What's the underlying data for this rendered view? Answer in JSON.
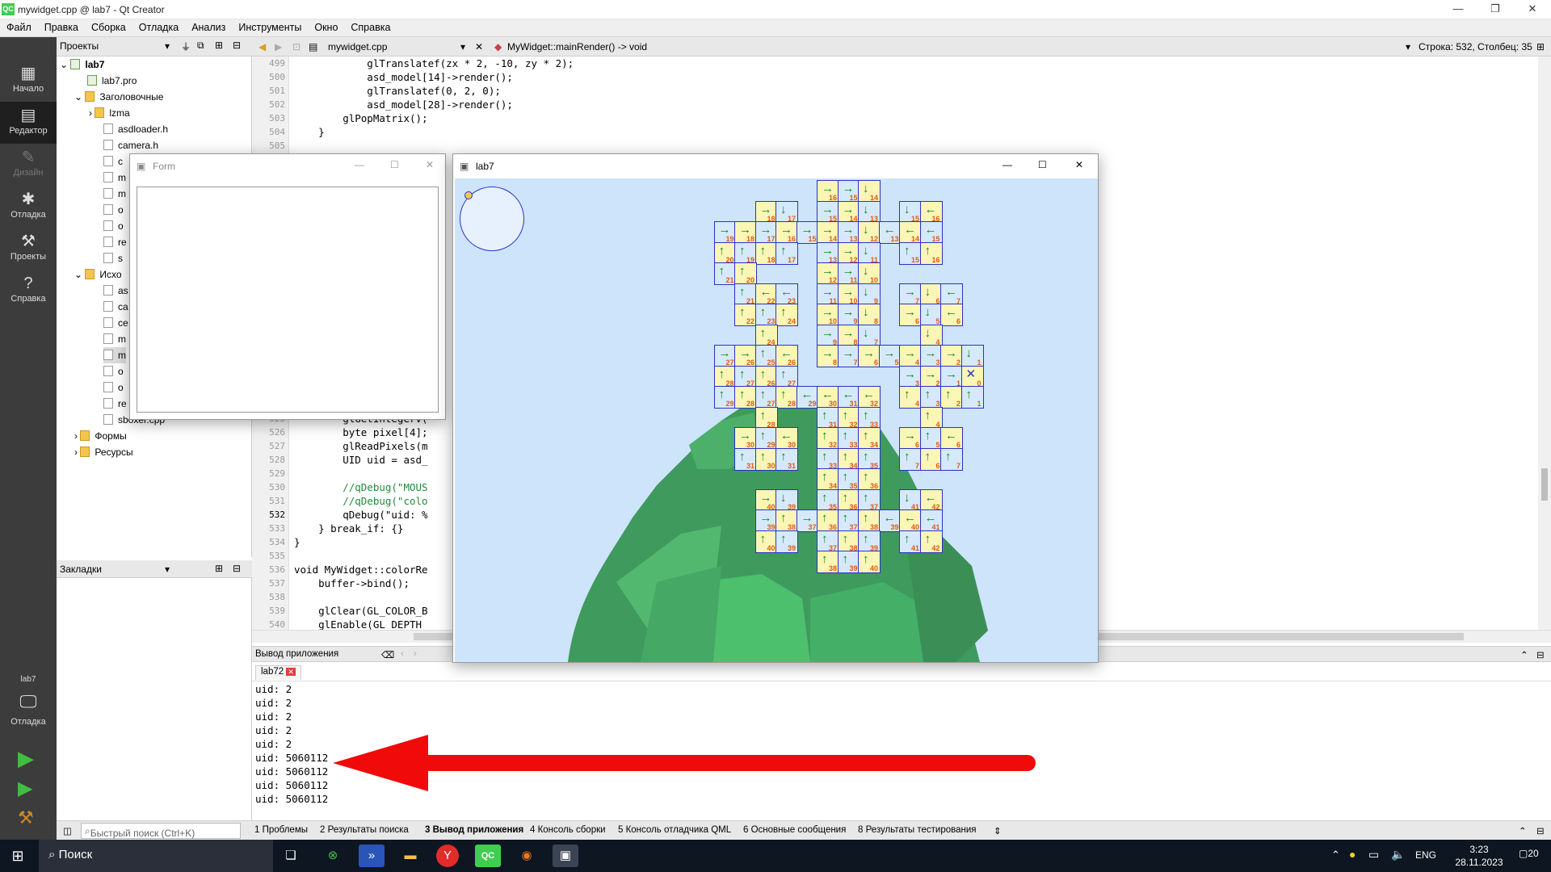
{
  "app": {
    "title": "mywidget.cpp @ lab7 - Qt Creator",
    "icon_text": "QC"
  },
  "window_controls": {
    "min": "—",
    "max": "❐",
    "close": "✕"
  },
  "menu": [
    "Файл",
    "Правка",
    "Сборка",
    "Отладка",
    "Анализ",
    "Инструменты",
    "Окно",
    "Справка"
  ],
  "modes": [
    {
      "label": "Начало",
      "icon": "grid-icon"
    },
    {
      "label": "Редактор",
      "icon": "editor-icon"
    },
    {
      "label": "Дизайн",
      "icon": "pen-icon"
    },
    {
      "label": "Отладка",
      "icon": "bug-icon"
    },
    {
      "label": "Проекты",
      "icon": "wrench-icon"
    },
    {
      "label": "Справка",
      "icon": "help-icon"
    }
  ],
  "kit": {
    "project": "lab7",
    "label": "Отладка"
  },
  "projects_panel": {
    "title": "Проекты",
    "items": [
      {
        "label": "lab7",
        "bold": true
      },
      {
        "label": "lab7.pro"
      },
      {
        "label": "Заголовочные"
      },
      {
        "label": "lzma"
      },
      {
        "label": "asdloader.h"
      },
      {
        "label": "camera.h"
      },
      {
        "label": "c"
      },
      {
        "label": "m"
      },
      {
        "label": "m"
      },
      {
        "label": "o"
      },
      {
        "label": "o"
      },
      {
        "label": "re"
      },
      {
        "label": "s"
      },
      {
        "label": "Исхо"
      },
      {
        "label": "as"
      },
      {
        "label": "ca"
      },
      {
        "label": "ce"
      },
      {
        "label": "m"
      },
      {
        "label": "m"
      },
      {
        "label": "o"
      },
      {
        "label": "o"
      },
      {
        "label": "re"
      },
      {
        "label": "sboxer.cpp"
      },
      {
        "label": "Формы"
      },
      {
        "label": "Ресурсы"
      }
    ]
  },
  "bookmarks_panel": {
    "title": "Закладки"
  },
  "editor": {
    "file": "mywidget.cpp",
    "function": "MyWidget::mainRender() -> void",
    "position": "Строка: 532, Столбец: 35",
    "lines": [
      {
        "n": "499",
        "text": "            glTranslatef(zx * 2, -10, zy * 2);"
      },
      {
        "n": "500",
        "text": "            asd_model[14]->render();"
      },
      {
        "n": "501",
        "text": "            glTranslatef(0, 2, 0);"
      },
      {
        "n": "502",
        "text": "            asd_model[28]->render();"
      },
      {
        "n": "503",
        "text": "        glPopMatrix();"
      },
      {
        "n": "504",
        "text": "    }"
      },
      {
        "n": "505",
        "text": ""
      },
      {
        "n": "525",
        "text": "        glGetIntegerv("
      },
      {
        "n": "526",
        "text": "        byte pixel[4];"
      },
      {
        "n": "527",
        "text": "        glReadPixels(m"
      },
      {
        "n": "528",
        "text": "        UID uid = asd_"
      },
      {
        "n": "529",
        "text": ""
      },
      {
        "n": "530",
        "text": "        //qDebug(\"MOUS"
      },
      {
        "n": "531",
        "text": "        //qDebug(\"colo"
      },
      {
        "n": "532",
        "text": "        qDebug(\"uid: %"
      },
      {
        "n": "533",
        "text": "    } break_if: {}"
      },
      {
        "n": "534",
        "text": "}"
      },
      {
        "n": "535",
        "text": ""
      },
      {
        "n": "536",
        "text": "void MyWidget::colorRe"
      },
      {
        "n": "537",
        "text": "    buffer->bind();"
      },
      {
        "n": "538",
        "text": ""
      },
      {
        "n": "539",
        "text": "    glClear(GL_COLOR_B"
      },
      {
        "n": "540",
        "text": "    glEnable(GL_DEPTH_"
      }
    ]
  },
  "output_panel": {
    "title": "Вывод приложения",
    "tab": "lab72",
    "lines": [
      "uid: 2",
      "uid: 2",
      "uid: 2",
      "uid: 2",
      "uid: 2",
      "uid: 5060112",
      "uid: 5060112",
      "uid: 5060112",
      "uid: 5060112"
    ]
  },
  "form_window": {
    "title": "Form"
  },
  "gl_window": {
    "title": "lab7"
  },
  "bottom_tabs": [
    {
      "label": "1  Проблемы"
    },
    {
      "label": "2  Результаты поиска"
    },
    {
      "label": "3  Вывод приложения"
    },
    {
      "label": "4  Консоль сборки"
    },
    {
      "label": "5  Консоль отладчика QML"
    },
    {
      "label": "6  Основные сообщения"
    },
    {
      "label": "8  Результаты тестирования"
    }
  ],
  "quick_search_placeholder": "Быстрый поиск (Ctrl+K)",
  "taskbar": {
    "search": "Поиск",
    "lang": "ENG",
    "time": "3:23",
    "date": "28.11.2023",
    "notif": "20"
  },
  "tiles": [
    [
      "r",
      16,
      0,
      0
    ],
    [
      "r",
      15,
      1,
      0
    ],
    [
      "d",
      14,
      2,
      0
    ],
    [
      "r",
      18,
      -3,
      1
    ],
    [
      "d",
      17,
      -2,
      1
    ],
    [
      "r",
      15,
      0,
      1
    ],
    [
      "r",
      14,
      1,
      1
    ],
    [
      "d",
      13,
      2,
      1
    ],
    [
      "d",
      15,
      4,
      1
    ],
    [
      "l",
      16,
      5,
      1
    ],
    [
      "r",
      19,
      -5,
      2
    ],
    [
      "r",
      18,
      -4,
      2
    ],
    [
      "r",
      17,
      -3,
      2
    ],
    [
      "r",
      16,
      -2,
      2
    ],
    [
      "r",
      15,
      -1,
      2
    ],
    [
      "r",
      14,
      0,
      2
    ],
    [
      "r",
      13,
      1,
      2
    ],
    [
      "d",
      12,
      2,
      2
    ],
    [
      "l",
      13,
      3,
      2
    ],
    [
      "l",
      14,
      4,
      2
    ],
    [
      "l",
      15,
      5,
      2
    ],
    [
      "u",
      20,
      -5,
      3
    ],
    [
      "u",
      19,
      -4,
      3
    ],
    [
      "u",
      18,
      -3,
      3
    ],
    [
      "u",
      17,
      -2,
      3
    ],
    [
      "r",
      13,
      0,
      3
    ],
    [
      "r",
      12,
      1,
      3
    ],
    [
      "d",
      11,
      2,
      3
    ],
    [
      "u",
      15,
      4,
      3
    ],
    [
      "u",
      16,
      5,
      3
    ],
    [
      "u",
      21,
      -5,
      4
    ],
    [
      "u",
      20,
      -4,
      4
    ],
    [
      "r",
      12,
      0,
      4
    ],
    [
      "r",
      11,
      1,
      4
    ],
    [
      "d",
      10,
      2,
      4
    ],
    [
      "u",
      21,
      -4,
      5
    ],
    [
      "l",
      22,
      -3,
      5
    ],
    [
      "l",
      23,
      -2,
      5
    ],
    [
      "r",
      11,
      0,
      5
    ],
    [
      "r",
      10,
      1,
      5
    ],
    [
      "d",
      9,
      2,
      5
    ],
    [
      "r",
      7,
      4,
      5
    ],
    [
      "d",
      6,
      5,
      5
    ],
    [
      "l",
      7,
      6,
      5
    ],
    [
      "u",
      22,
      -4,
      6
    ],
    [
      "u",
      23,
      -3,
      6
    ],
    [
      "u",
      24,
      -2,
      6
    ],
    [
      "r",
      10,
      0,
      6
    ],
    [
      "r",
      9,
      1,
      6
    ],
    [
      "d",
      8,
      2,
      6
    ],
    [
      "r",
      6,
      4,
      6
    ],
    [
      "d",
      5,
      5,
      6
    ],
    [
      "l",
      6,
      6,
      6
    ],
    [
      "u",
      24,
      -3,
      7
    ],
    [
      "r",
      9,
      0,
      7
    ],
    [
      "r",
      8,
      1,
      7
    ],
    [
      "d",
      7,
      2,
      7
    ],
    [
      "d",
      4,
      5,
      7
    ],
    [
      "r",
      27,
      -5,
      8
    ],
    [
      "r",
      26,
      -4,
      8
    ],
    [
      "u",
      25,
      -3,
      8
    ],
    [
      "l",
      26,
      -2,
      8
    ],
    [
      "r",
      8,
      0,
      8
    ],
    [
      "r",
      7,
      1,
      8
    ],
    [
      "r",
      6,
      2,
      8
    ],
    [
      "r",
      5,
      3,
      8
    ],
    [
      "r",
      4,
      4,
      8
    ],
    [
      "r",
      3,
      5,
      8
    ],
    [
      "r",
      2,
      6,
      8
    ],
    [
      "d",
      1,
      7,
      8
    ],
    [
      "u",
      28,
      -5,
      9
    ],
    [
      "u",
      27,
      -4,
      9
    ],
    [
      "u",
      26,
      -3,
      9
    ],
    [
      "u",
      27,
      -2,
      9
    ],
    [
      "r",
      3,
      4,
      9
    ],
    [
      "r",
      2,
      5,
      9
    ],
    [
      "r",
      1,
      6,
      9
    ],
    [
      "x",
      0,
      7,
      9
    ],
    [
      "u",
      29,
      -5,
      10
    ],
    [
      "u",
      28,
      -4,
      10
    ],
    [
      "u",
      27,
      -3,
      10
    ],
    [
      "u",
      28,
      -2,
      10
    ],
    [
      "l",
      29,
      -1,
      10
    ],
    [
      "l",
      30,
      0,
      10
    ],
    [
      "l",
      31,
      1,
      10
    ],
    [
      "l",
      32,
      2,
      10
    ],
    [
      "u",
      4,
      4,
      10
    ],
    [
      "u",
      3,
      5,
      10
    ],
    [
      "u",
      2,
      6,
      10
    ],
    [
      "u",
      1,
      7,
      10
    ],
    [
      "u",
      28,
      -3,
      11
    ],
    [
      "u",
      31,
      0,
      11
    ],
    [
      "u",
      32,
      1,
      11
    ],
    [
      "u",
      33,
      2,
      11
    ],
    [
      "u",
      4,
      5,
      11
    ],
    [
      "r",
      30,
      -4,
      12
    ],
    [
      "u",
      29,
      -3,
      12
    ],
    [
      "l",
      30,
      -2,
      12
    ],
    [
      "u",
      32,
      0,
      12
    ],
    [
      "u",
      33,
      1,
      12
    ],
    [
      "u",
      34,
      2,
      12
    ],
    [
      "r",
      6,
      4,
      12
    ],
    [
      "u",
      5,
      5,
      12
    ],
    [
      "l",
      6,
      6,
      12
    ],
    [
      "u",
      31,
      -4,
      13
    ],
    [
      "u",
      30,
      -3,
      13
    ],
    [
      "u",
      31,
      -2,
      13
    ],
    [
      "u",
      33,
      0,
      13
    ],
    [
      "u",
      34,
      1,
      13
    ],
    [
      "u",
      35,
      2,
      13
    ],
    [
      "u",
      7,
      4,
      13
    ],
    [
      "u",
      6,
      5,
      13
    ],
    [
      "u",
      7,
      6,
      13
    ],
    [
      "u",
      34,
      0,
      14
    ],
    [
      "u",
      35,
      1,
      14
    ],
    [
      "u",
      36,
      2,
      14
    ],
    [
      "r",
      40,
      -3,
      15
    ],
    [
      "d",
      39,
      -2,
      15
    ],
    [
      "u",
      35,
      0,
      15
    ],
    [
      "u",
      36,
      1,
      15
    ],
    [
      "u",
      37,
      2,
      15
    ],
    [
      "d",
      41,
      4,
      15
    ],
    [
      "l",
      42,
      5,
      15
    ],
    [
      "r",
      39,
      -3,
      16
    ],
    [
      "u",
      38,
      -2,
      16
    ],
    [
      "r",
      37,
      -1,
      16
    ],
    [
      "u",
      36,
      0,
      16
    ],
    [
      "u",
      37,
      1,
      16
    ],
    [
      "u",
      38,
      2,
      16
    ],
    [
      "l",
      39,
      3,
      16
    ],
    [
      "l",
      40,
      4,
      16
    ],
    [
      "l",
      41,
      5,
      16
    ],
    [
      "u",
      40,
      -3,
      17
    ],
    [
      "u",
      39,
      -2,
      17
    ],
    [
      "u",
      37,
      0,
      17
    ],
    [
      "u",
      38,
      1,
      17
    ],
    [
      "u",
      39,
      2,
      17
    ],
    [
      "u",
      41,
      4,
      17
    ],
    [
      "u",
      42,
      5,
      17
    ],
    [
      "u",
      38,
      0,
      18
    ],
    [
      "u",
      39,
      1,
      18
    ],
    [
      "u",
      40,
      2,
      18
    ]
  ]
}
